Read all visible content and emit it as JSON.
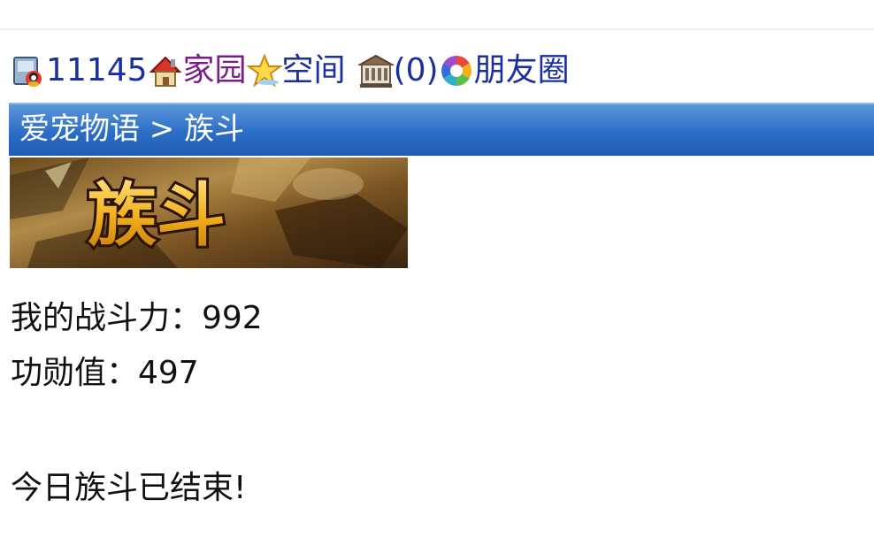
{
  "nav": {
    "user_id": "11145",
    "home": "家园",
    "space": "空间",
    "messages_count": "(0)",
    "friends": "朋友圈"
  },
  "title_bar": {
    "breadcrumb": "爱宠物语 > 族斗"
  },
  "banner": {
    "logo_text": "族斗"
  },
  "stats": {
    "combat_power": "我的战斗力：992",
    "merit": "功勋值：497"
  },
  "status_message": "今日族斗已结束!",
  "colors": {
    "link": "#1a2fa0",
    "visited_link": "#7a1f8a",
    "title_bar": "#2b6ec7",
    "banner_text": "#f2b01e"
  }
}
